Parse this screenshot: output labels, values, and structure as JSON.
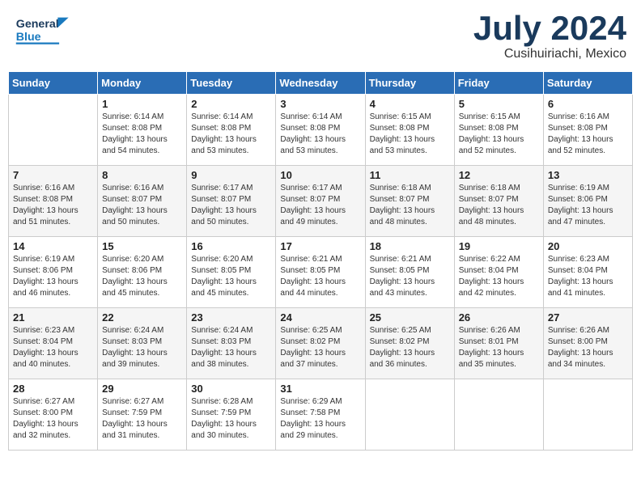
{
  "header": {
    "logo_general": "General",
    "logo_blue": "Blue",
    "month_year": "July 2024",
    "location": "Cusihuiriachi, Mexico"
  },
  "days_of_week": [
    "Sunday",
    "Monday",
    "Tuesday",
    "Wednesday",
    "Thursday",
    "Friday",
    "Saturday"
  ],
  "weeks": [
    [
      {
        "day": "",
        "sunrise": "",
        "sunset": "",
        "daylight": ""
      },
      {
        "day": "1",
        "sunrise": "Sunrise: 6:14 AM",
        "sunset": "Sunset: 8:08 PM",
        "daylight": "Daylight: 13 hours and 54 minutes."
      },
      {
        "day": "2",
        "sunrise": "Sunrise: 6:14 AM",
        "sunset": "Sunset: 8:08 PM",
        "daylight": "Daylight: 13 hours and 53 minutes."
      },
      {
        "day": "3",
        "sunrise": "Sunrise: 6:14 AM",
        "sunset": "Sunset: 8:08 PM",
        "daylight": "Daylight: 13 hours and 53 minutes."
      },
      {
        "day": "4",
        "sunrise": "Sunrise: 6:15 AM",
        "sunset": "Sunset: 8:08 PM",
        "daylight": "Daylight: 13 hours and 53 minutes."
      },
      {
        "day": "5",
        "sunrise": "Sunrise: 6:15 AM",
        "sunset": "Sunset: 8:08 PM",
        "daylight": "Daylight: 13 hours and 52 minutes."
      },
      {
        "day": "6",
        "sunrise": "Sunrise: 6:16 AM",
        "sunset": "Sunset: 8:08 PM",
        "daylight": "Daylight: 13 hours and 52 minutes."
      }
    ],
    [
      {
        "day": "7",
        "sunrise": "Sunrise: 6:16 AM",
        "sunset": "Sunset: 8:08 PM",
        "daylight": "Daylight: 13 hours and 51 minutes."
      },
      {
        "day": "8",
        "sunrise": "Sunrise: 6:16 AM",
        "sunset": "Sunset: 8:07 PM",
        "daylight": "Daylight: 13 hours and 50 minutes."
      },
      {
        "day": "9",
        "sunrise": "Sunrise: 6:17 AM",
        "sunset": "Sunset: 8:07 PM",
        "daylight": "Daylight: 13 hours and 50 minutes."
      },
      {
        "day": "10",
        "sunrise": "Sunrise: 6:17 AM",
        "sunset": "Sunset: 8:07 PM",
        "daylight": "Daylight: 13 hours and 49 minutes."
      },
      {
        "day": "11",
        "sunrise": "Sunrise: 6:18 AM",
        "sunset": "Sunset: 8:07 PM",
        "daylight": "Daylight: 13 hours and 48 minutes."
      },
      {
        "day": "12",
        "sunrise": "Sunrise: 6:18 AM",
        "sunset": "Sunset: 8:07 PM",
        "daylight": "Daylight: 13 hours and 48 minutes."
      },
      {
        "day": "13",
        "sunrise": "Sunrise: 6:19 AM",
        "sunset": "Sunset: 8:06 PM",
        "daylight": "Daylight: 13 hours and 47 minutes."
      }
    ],
    [
      {
        "day": "14",
        "sunrise": "Sunrise: 6:19 AM",
        "sunset": "Sunset: 8:06 PM",
        "daylight": "Daylight: 13 hours and 46 minutes."
      },
      {
        "day": "15",
        "sunrise": "Sunrise: 6:20 AM",
        "sunset": "Sunset: 8:06 PM",
        "daylight": "Daylight: 13 hours and 45 minutes."
      },
      {
        "day": "16",
        "sunrise": "Sunrise: 6:20 AM",
        "sunset": "Sunset: 8:05 PM",
        "daylight": "Daylight: 13 hours and 45 minutes."
      },
      {
        "day": "17",
        "sunrise": "Sunrise: 6:21 AM",
        "sunset": "Sunset: 8:05 PM",
        "daylight": "Daylight: 13 hours and 44 minutes."
      },
      {
        "day": "18",
        "sunrise": "Sunrise: 6:21 AM",
        "sunset": "Sunset: 8:05 PM",
        "daylight": "Daylight: 13 hours and 43 minutes."
      },
      {
        "day": "19",
        "sunrise": "Sunrise: 6:22 AM",
        "sunset": "Sunset: 8:04 PM",
        "daylight": "Daylight: 13 hours and 42 minutes."
      },
      {
        "day": "20",
        "sunrise": "Sunrise: 6:23 AM",
        "sunset": "Sunset: 8:04 PM",
        "daylight": "Daylight: 13 hours and 41 minutes."
      }
    ],
    [
      {
        "day": "21",
        "sunrise": "Sunrise: 6:23 AM",
        "sunset": "Sunset: 8:04 PM",
        "daylight": "Daylight: 13 hours and 40 minutes."
      },
      {
        "day": "22",
        "sunrise": "Sunrise: 6:24 AM",
        "sunset": "Sunset: 8:03 PM",
        "daylight": "Daylight: 13 hours and 39 minutes."
      },
      {
        "day": "23",
        "sunrise": "Sunrise: 6:24 AM",
        "sunset": "Sunset: 8:03 PM",
        "daylight": "Daylight: 13 hours and 38 minutes."
      },
      {
        "day": "24",
        "sunrise": "Sunrise: 6:25 AM",
        "sunset": "Sunset: 8:02 PM",
        "daylight": "Daylight: 13 hours and 37 minutes."
      },
      {
        "day": "25",
        "sunrise": "Sunrise: 6:25 AM",
        "sunset": "Sunset: 8:02 PM",
        "daylight": "Daylight: 13 hours and 36 minutes."
      },
      {
        "day": "26",
        "sunrise": "Sunrise: 6:26 AM",
        "sunset": "Sunset: 8:01 PM",
        "daylight": "Daylight: 13 hours and 35 minutes."
      },
      {
        "day": "27",
        "sunrise": "Sunrise: 6:26 AM",
        "sunset": "Sunset: 8:00 PM",
        "daylight": "Daylight: 13 hours and 34 minutes."
      }
    ],
    [
      {
        "day": "28",
        "sunrise": "Sunrise: 6:27 AM",
        "sunset": "Sunset: 8:00 PM",
        "daylight": "Daylight: 13 hours and 32 minutes."
      },
      {
        "day": "29",
        "sunrise": "Sunrise: 6:27 AM",
        "sunset": "Sunset: 7:59 PM",
        "daylight": "Daylight: 13 hours and 31 minutes."
      },
      {
        "day": "30",
        "sunrise": "Sunrise: 6:28 AM",
        "sunset": "Sunset: 7:59 PM",
        "daylight": "Daylight: 13 hours and 30 minutes."
      },
      {
        "day": "31",
        "sunrise": "Sunrise: 6:29 AM",
        "sunset": "Sunset: 7:58 PM",
        "daylight": "Daylight: 13 hours and 29 minutes."
      },
      {
        "day": "",
        "sunrise": "",
        "sunset": "",
        "daylight": ""
      },
      {
        "day": "",
        "sunrise": "",
        "sunset": "",
        "daylight": ""
      },
      {
        "day": "",
        "sunrise": "",
        "sunset": "",
        "daylight": ""
      }
    ]
  ]
}
